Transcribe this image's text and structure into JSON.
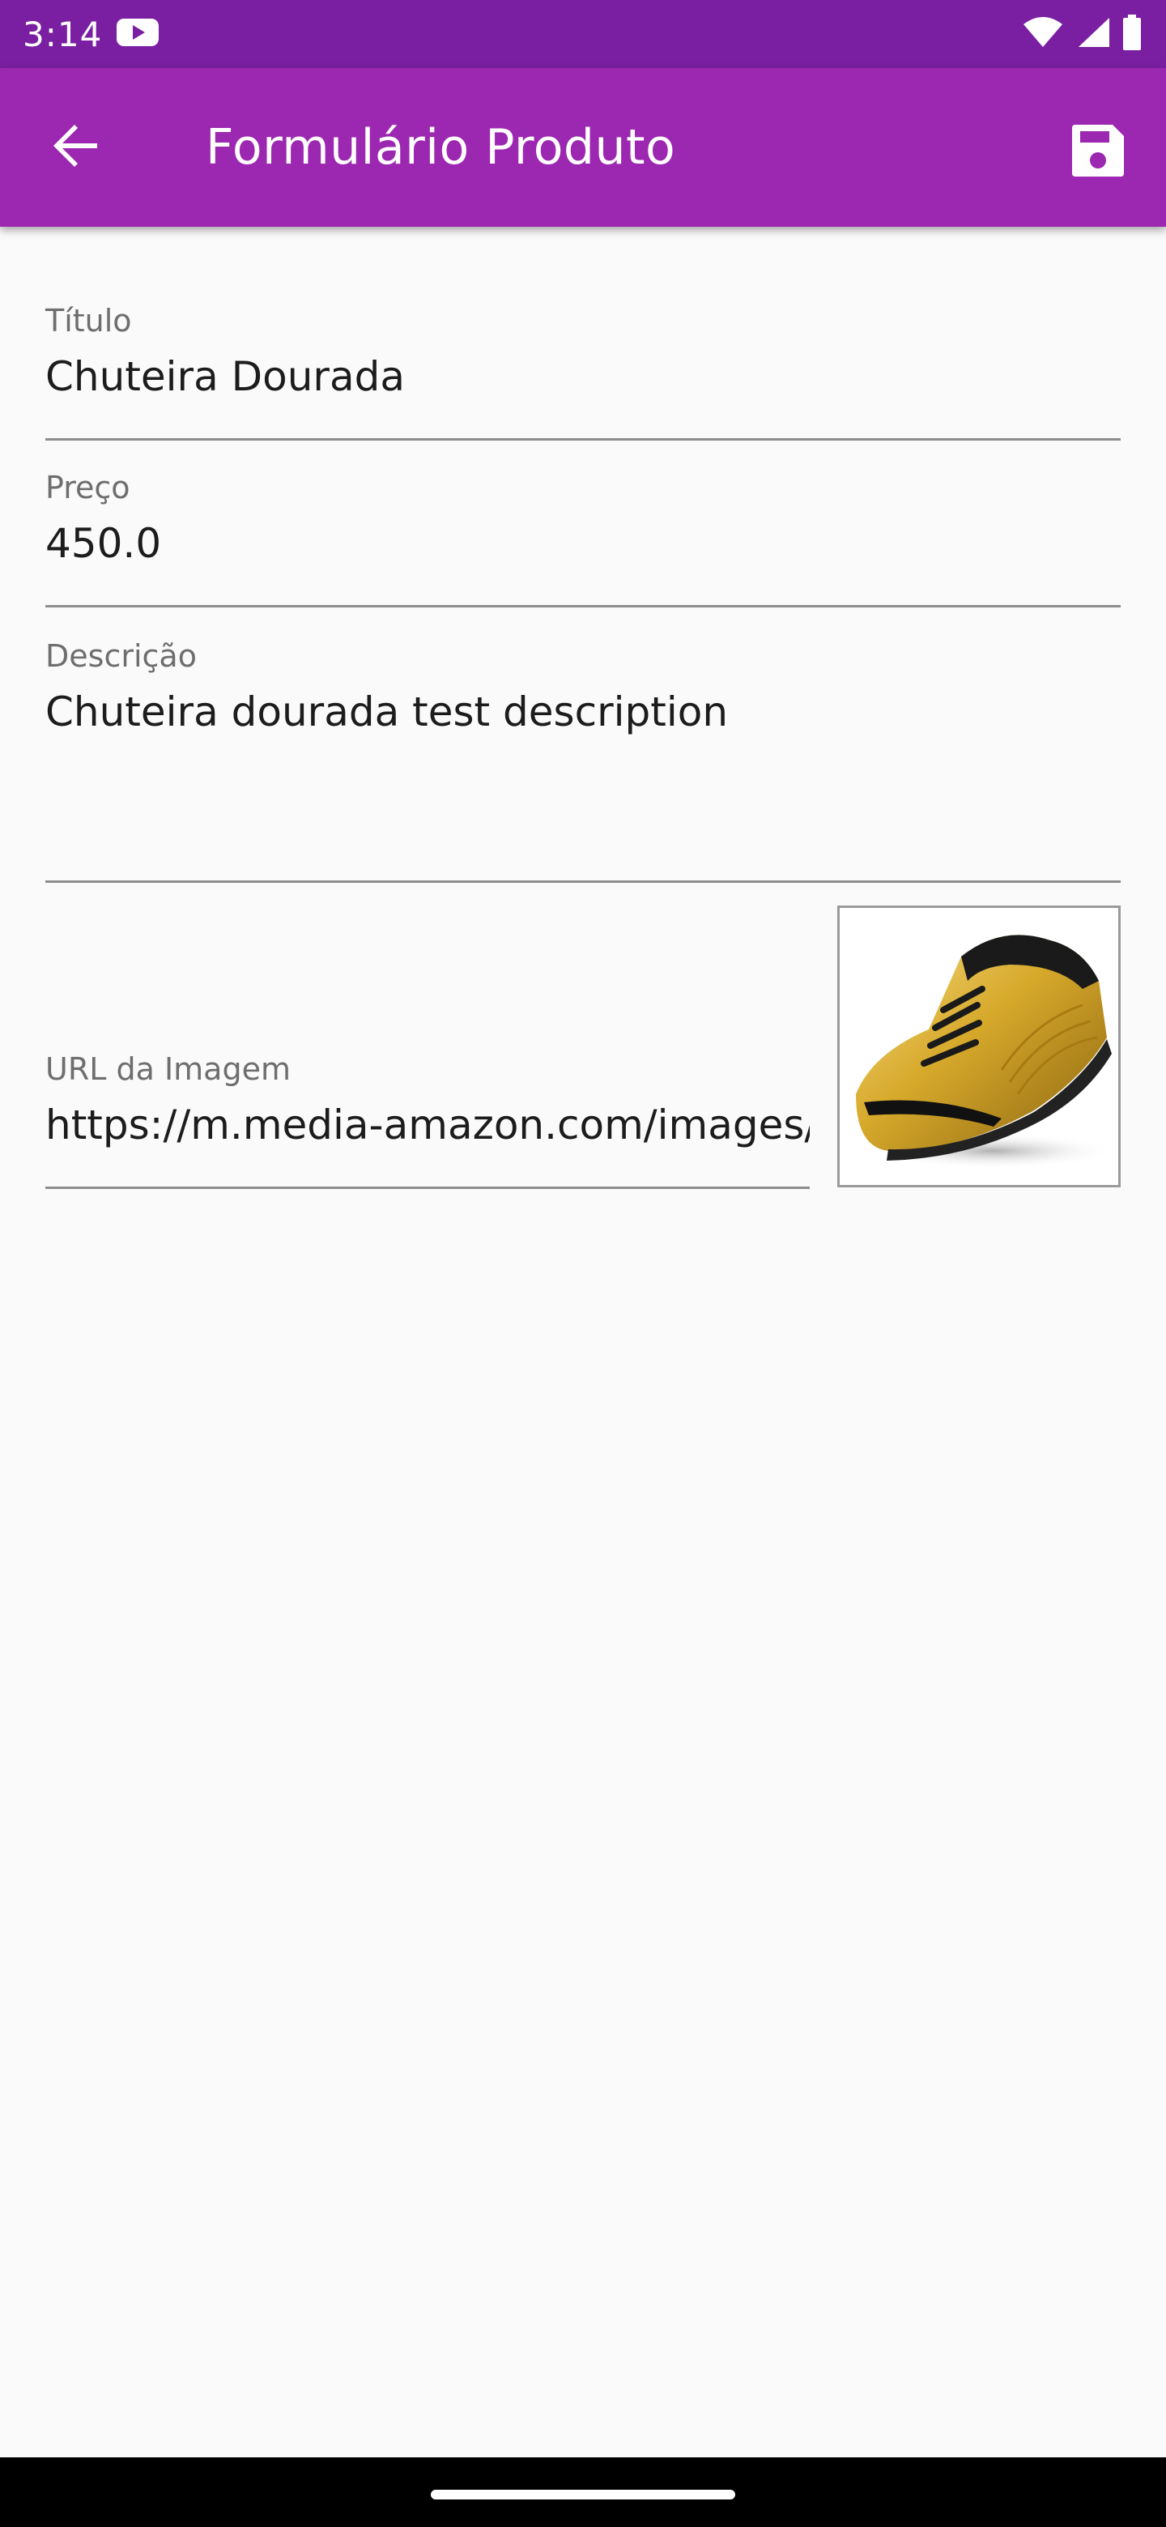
{
  "status_bar": {
    "time": "3:14"
  },
  "app_bar": {
    "title": "Formulário Produto",
    "background_color": "#9c27b0",
    "status_color": "#7b1fa2"
  },
  "form": {
    "title_field": {
      "label": "Título",
      "value": "Chuteira Dourada"
    },
    "price_field": {
      "label": "Preço",
      "value": "450.0"
    },
    "description_field": {
      "label": "Descrição",
      "value": "Chuteira dourada test description"
    },
    "image_url_field": {
      "label": "URL da Imagem",
      "value": "https://m.media-amazon.com/images/I/"
    }
  },
  "icons": {
    "back": "arrow-back-icon",
    "save": "save-icon",
    "youtube": "youtube-icon",
    "wifi": "wifi-icon",
    "signal": "signal-icon",
    "battery": "battery-icon"
  }
}
